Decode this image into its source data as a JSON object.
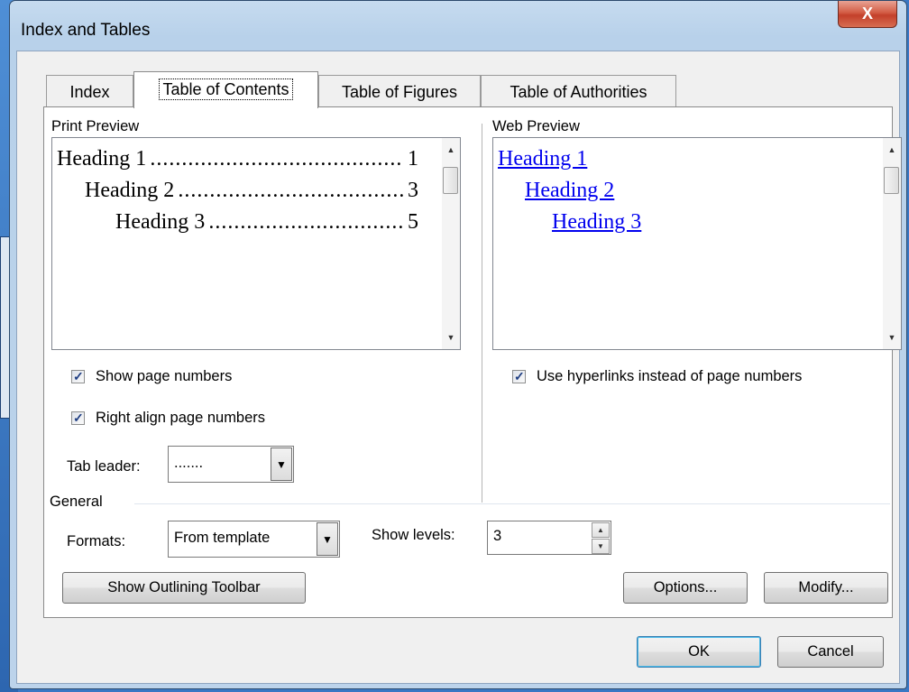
{
  "dialog": {
    "title": "Index and Tables",
    "close_glyph": "X"
  },
  "tabs": [
    {
      "label": "Index",
      "active": false
    },
    {
      "label": "Table of Contents",
      "active": true
    },
    {
      "label": "Table of Figures",
      "active": false
    },
    {
      "label": "Table of Authorities",
      "active": false
    }
  ],
  "print_preview": {
    "label": "Print Preview",
    "entries": [
      {
        "text": "Heading 1",
        "page": "1"
      },
      {
        "text": "Heading 2",
        "page": "3"
      },
      {
        "text": "Heading 3",
        "page": "5"
      }
    ]
  },
  "web_preview": {
    "label": "Web Preview",
    "links": [
      "Heading 1",
      "Heading 2",
      "Heading 3"
    ]
  },
  "options": {
    "show_page_numbers": {
      "label": "Show page numbers",
      "checked": true
    },
    "right_align_page_numbers": {
      "label": "Right align page numbers",
      "checked": true
    },
    "use_hyperlinks": {
      "label": "Use hyperlinks instead of page numbers",
      "checked": true
    },
    "tab_leader": {
      "label": "Tab leader:",
      "value": "......."
    }
  },
  "general": {
    "label": "General",
    "formats_label": "Formats:",
    "formats_value": "From template",
    "show_levels_label": "Show levels:",
    "show_levels_value": "3"
  },
  "buttons": {
    "show_outlining_toolbar": "Show Outlining Toolbar",
    "options": "Options...",
    "modify": "Modify...",
    "ok": "OK",
    "cancel": "Cancel"
  },
  "icons": {
    "dropdown_arrow": "▼",
    "spin_up": "▲",
    "spin_down": "▼",
    "check": "✓"
  },
  "colors": {
    "link": "#0000ee",
    "close_button": "#c3402a",
    "title_bar": "#c6dbef",
    "default_button_border": "#3c7fb1"
  }
}
